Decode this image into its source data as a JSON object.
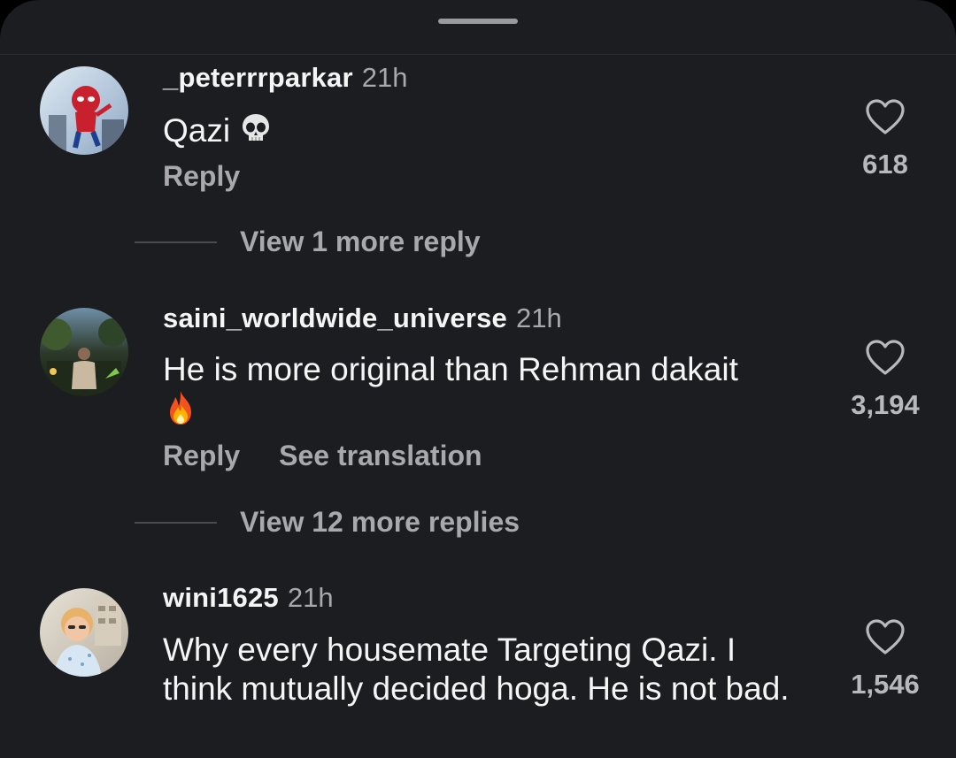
{
  "comments": [
    {
      "username": "_peterrrparkar",
      "time": "21h",
      "text": "Qazi",
      "emoji": "skull",
      "like_count": "618",
      "actions": [
        "Reply"
      ],
      "view_replies": "View 1 more reply"
    },
    {
      "username": "saini_worldwide_universe",
      "time": "21h",
      "text": "He is more original than Rehman dakait",
      "emoji": "fire",
      "like_count": "3,194",
      "actions": [
        "Reply",
        "See translation"
      ],
      "view_replies": "View 12 more replies"
    },
    {
      "username": "wini1625",
      "time": "21h",
      "text": "Why every housemate Targeting Qazi. I think mutually decided hoga. He is not bad.",
      "like_count": "1,546"
    }
  ],
  "colors": {
    "background": "#1c1d21",
    "primary_text": "#f5f5f5",
    "secondary_text": "#a8a8ad"
  }
}
